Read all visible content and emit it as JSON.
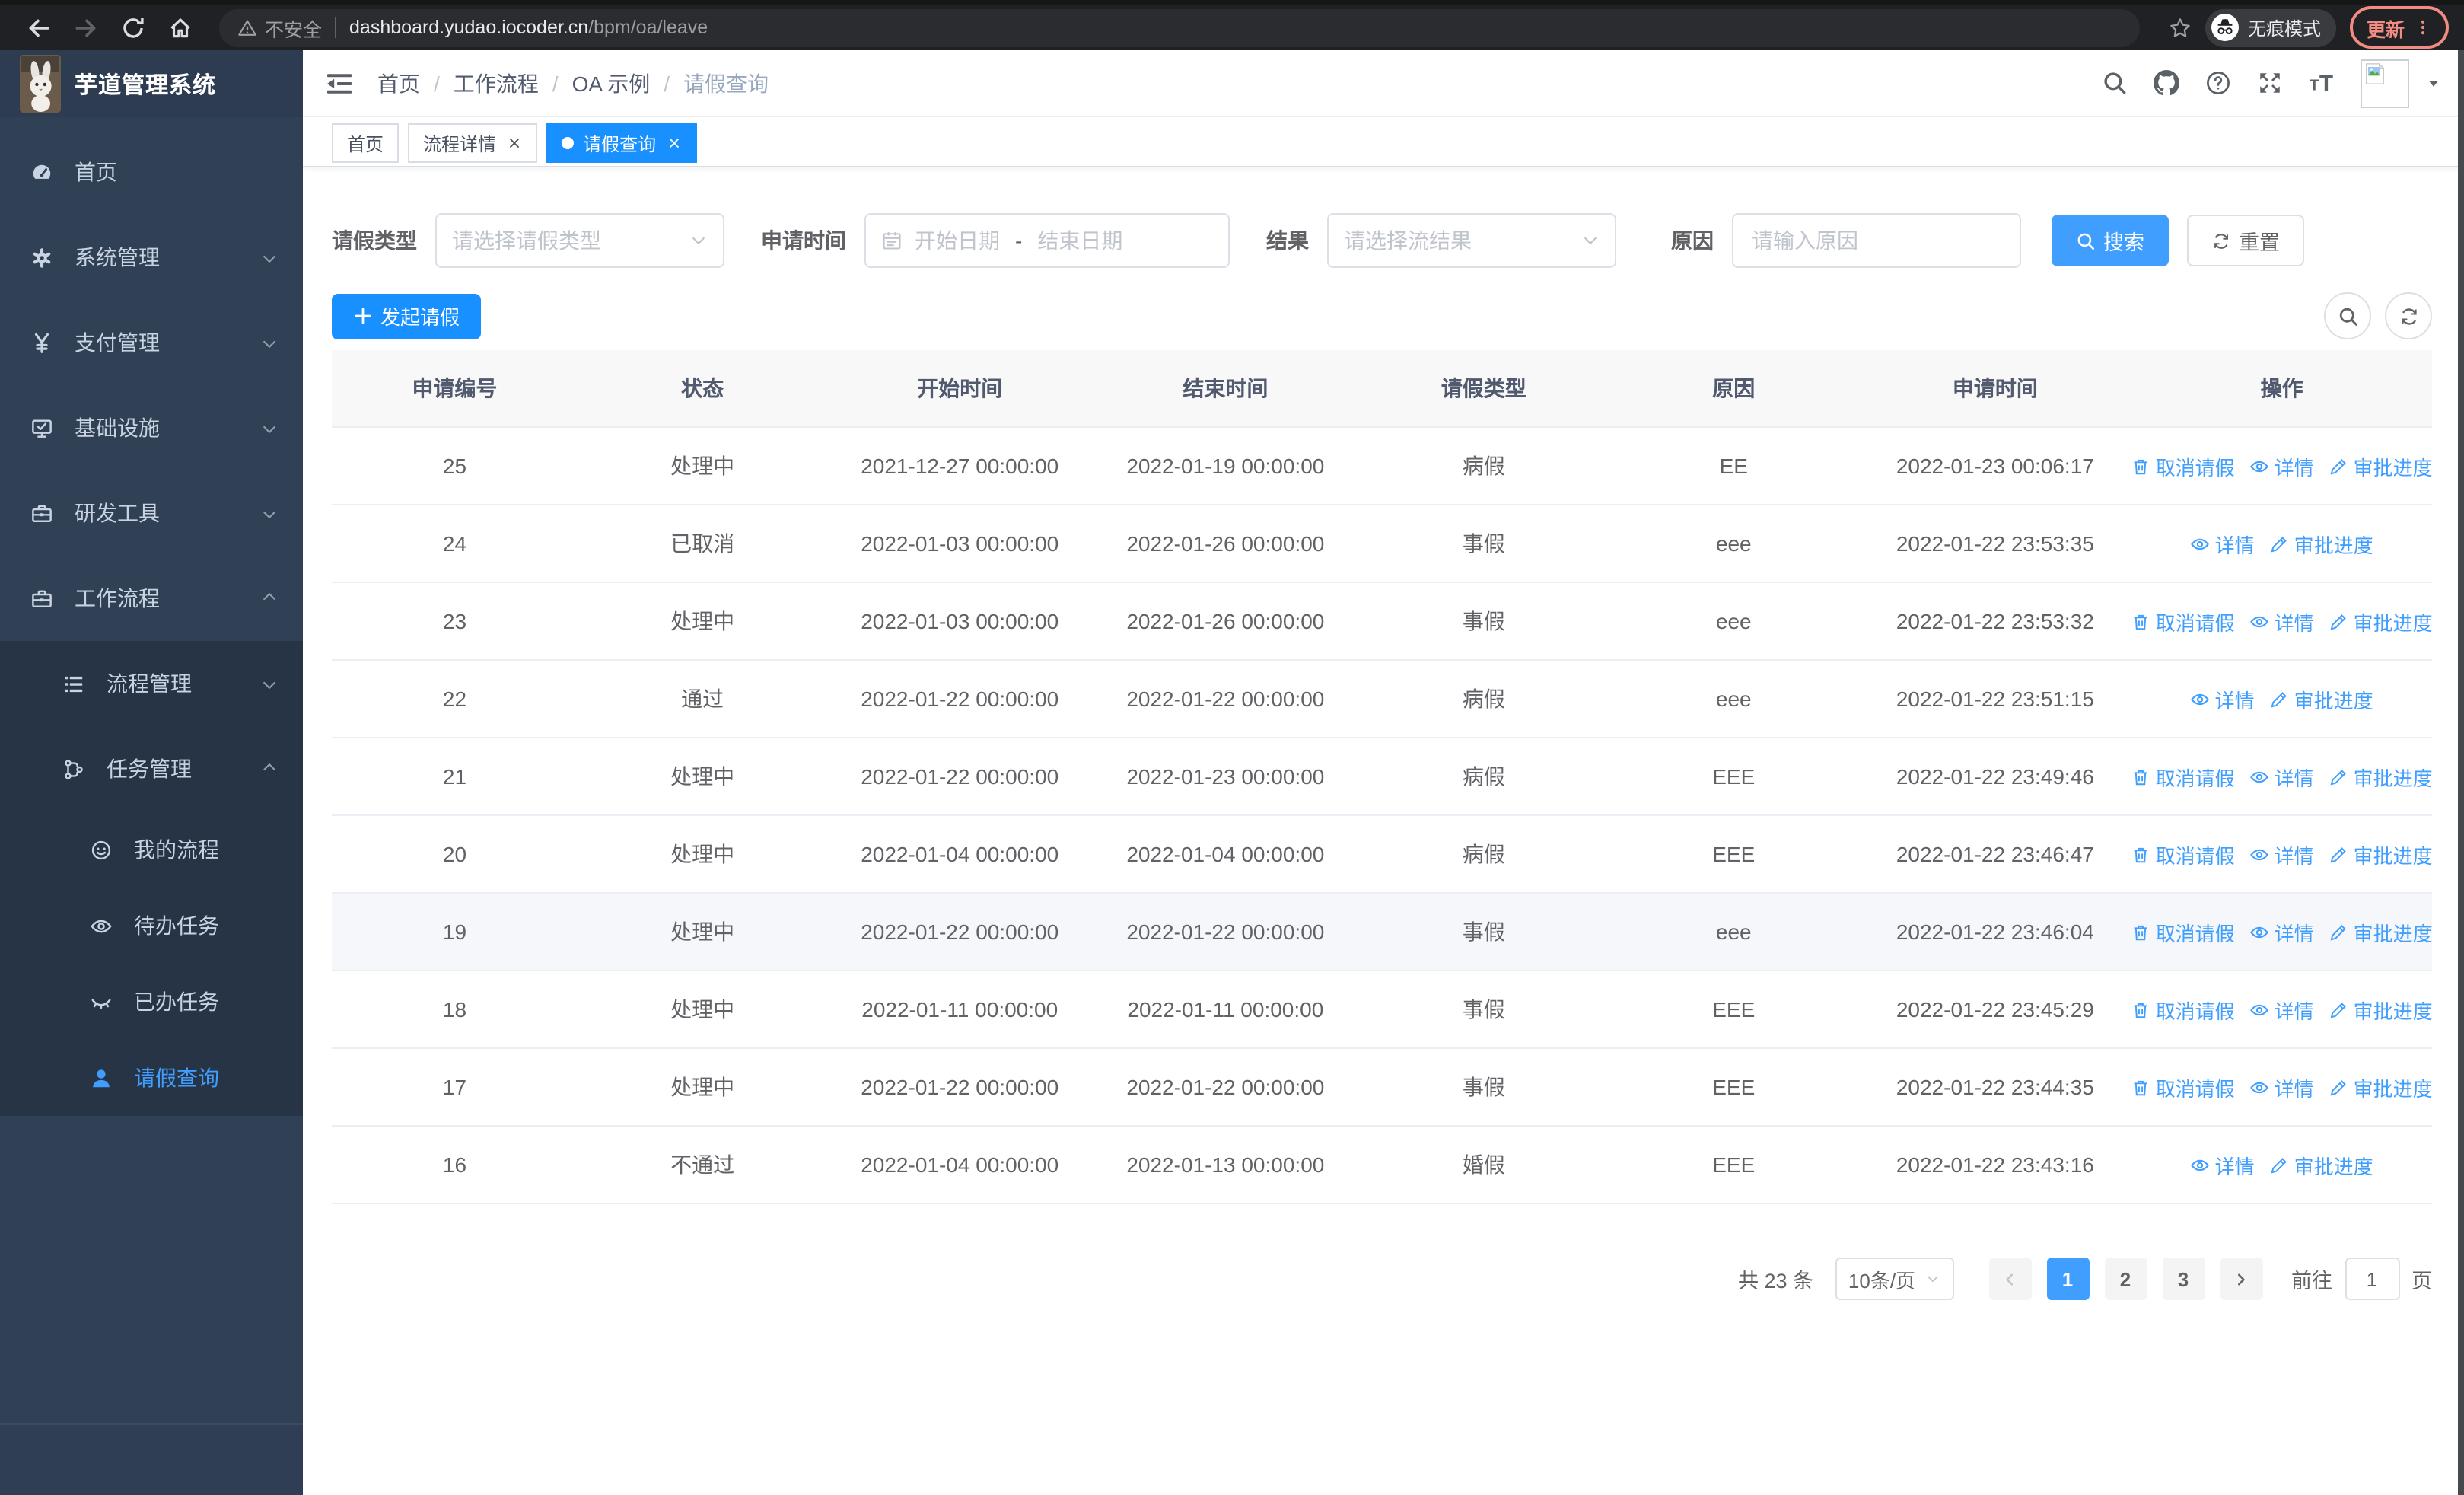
{
  "browser": {
    "security_label": "不安全",
    "url_host": "dashboard.yudao.iocoder.cn",
    "url_path": "/bpm/oa/leave",
    "incognito_label": "无痕模式",
    "update_label": "更新"
  },
  "app": {
    "logo_title": "芋道管理系统",
    "breadcrumb": [
      "首页",
      "工作流程",
      "OA 示例",
      "请假查询"
    ],
    "breadcrumb_separator": "/"
  },
  "tabs": [
    {
      "label": "首页",
      "closable": false,
      "active": false
    },
    {
      "label": "流程详情",
      "closable": true,
      "active": false
    },
    {
      "label": "请假查询",
      "closable": true,
      "active": true
    }
  ],
  "sidebar": {
    "items": [
      {
        "key": "home",
        "label": "首页",
        "icon": "dashboard-icon",
        "level": 1
      },
      {
        "key": "system-mgmt",
        "label": "系统管理",
        "icon": "gear-icon",
        "level": 1,
        "chevron": "down"
      },
      {
        "key": "payment-mgmt",
        "label": "支付管理",
        "icon": "yen-icon",
        "level": 1,
        "chevron": "down"
      },
      {
        "key": "infrastructure",
        "label": "基础设施",
        "icon": "monitor-icon",
        "level": 1,
        "chevron": "down"
      },
      {
        "key": "dev-tools",
        "label": "研发工具",
        "icon": "toolbox-icon",
        "level": 1,
        "chevron": "down"
      },
      {
        "key": "workflow",
        "label": "工作流程",
        "icon": "toolbox-icon",
        "level": 1,
        "chevron": "up"
      },
      {
        "key": "process-mgmt",
        "label": "流程管理",
        "icon": "list-icon",
        "level": 2,
        "chevron": "down"
      },
      {
        "key": "task-mgmt",
        "label": "任务管理",
        "icon": "branch-icon",
        "level": 2,
        "chevron": "up"
      },
      {
        "key": "my-process",
        "label": "我的流程",
        "icon": "face-icon",
        "level": 3
      },
      {
        "key": "todo-tasks",
        "label": "待办任务",
        "icon": "eye-icon",
        "level": 3
      },
      {
        "key": "done-tasks",
        "label": "已办任务",
        "icon": "eye-closed-icon",
        "level": 3
      },
      {
        "key": "leave-query",
        "label": "请假查询",
        "icon": "user-icon",
        "level": 3,
        "active": true
      }
    ]
  },
  "filters": {
    "leave_type": {
      "label": "请假类型",
      "placeholder": "请选择请假类型"
    },
    "apply_time": {
      "label": "申请时间",
      "start_placeholder": "开始日期",
      "separator": "-",
      "end_placeholder": "结束日期"
    },
    "result": {
      "label": "结果",
      "placeholder": "请选择流结果"
    },
    "reason": {
      "label": "原因",
      "placeholder": "请输入原因"
    },
    "search_label": "搜索",
    "reset_label": "重置"
  },
  "toolbar": {
    "create_label": "发起请假"
  },
  "table": {
    "columns": [
      "申请编号",
      "状态",
      "开始时间",
      "结束时间",
      "请假类型",
      "原因",
      "申请时间",
      "操作"
    ],
    "action_labels": {
      "cancel": "取消请假",
      "detail": "详情",
      "progress": "审批进度"
    },
    "rows": [
      {
        "id": "25",
        "status": "处理中",
        "start": "2021-12-27 00:00:00",
        "end": "2022-01-19 00:00:00",
        "type": "病假",
        "reason": "EE",
        "applied": "2022-01-23 00:06:17",
        "actions": [
          "cancel",
          "detail",
          "progress"
        ],
        "highlight": false
      },
      {
        "id": "24",
        "status": "已取消",
        "start": "2022-01-03 00:00:00",
        "end": "2022-01-26 00:00:00",
        "type": "事假",
        "reason": "eee",
        "applied": "2022-01-22 23:53:35",
        "actions": [
          "detail",
          "progress"
        ],
        "highlight": false
      },
      {
        "id": "23",
        "status": "处理中",
        "start": "2022-01-03 00:00:00",
        "end": "2022-01-26 00:00:00",
        "type": "事假",
        "reason": "eee",
        "applied": "2022-01-22 23:53:32",
        "actions": [
          "cancel",
          "detail",
          "progress"
        ],
        "highlight": false
      },
      {
        "id": "22",
        "status": "通过",
        "start": "2022-01-22 00:00:00",
        "end": "2022-01-22 00:00:00",
        "type": "病假",
        "reason": "eee",
        "applied": "2022-01-22 23:51:15",
        "actions": [
          "detail",
          "progress"
        ],
        "highlight": false
      },
      {
        "id": "21",
        "status": "处理中",
        "start": "2022-01-22 00:00:00",
        "end": "2022-01-23 00:00:00",
        "type": "病假",
        "reason": "EEE",
        "applied": "2022-01-22 23:49:46",
        "actions": [
          "cancel",
          "detail",
          "progress"
        ],
        "highlight": false
      },
      {
        "id": "20",
        "status": "处理中",
        "start": "2022-01-04 00:00:00",
        "end": "2022-01-04 00:00:00",
        "type": "病假",
        "reason": "EEE",
        "applied": "2022-01-22 23:46:47",
        "actions": [
          "cancel",
          "detail",
          "progress"
        ],
        "highlight": false
      },
      {
        "id": "19",
        "status": "处理中",
        "start": "2022-01-22 00:00:00",
        "end": "2022-01-22 00:00:00",
        "type": "事假",
        "reason": "eee",
        "applied": "2022-01-22 23:46:04",
        "actions": [
          "cancel",
          "detail",
          "progress"
        ],
        "highlight": true
      },
      {
        "id": "18",
        "status": "处理中",
        "start": "2022-01-11 00:00:00",
        "end": "2022-01-11 00:00:00",
        "type": "事假",
        "reason": "EEE",
        "applied": "2022-01-22 23:45:29",
        "actions": [
          "cancel",
          "detail",
          "progress"
        ],
        "highlight": false
      },
      {
        "id": "17",
        "status": "处理中",
        "start": "2022-01-22 00:00:00",
        "end": "2022-01-22 00:00:00",
        "type": "事假",
        "reason": "EEE",
        "applied": "2022-01-22 23:44:35",
        "actions": [
          "cancel",
          "detail",
          "progress"
        ],
        "highlight": false
      },
      {
        "id": "16",
        "status": "不通过",
        "start": "2022-01-04 00:00:00",
        "end": "2022-01-13 00:00:00",
        "type": "婚假",
        "reason": "EEE",
        "applied": "2022-01-22 23:43:16",
        "actions": [
          "detail",
          "progress"
        ],
        "highlight": false
      }
    ]
  },
  "pagination": {
    "total_label": "共 23 条",
    "page_size": "10条/页",
    "pages": [
      "1",
      "2",
      "3"
    ],
    "active_page": "1",
    "goto_label": "前往",
    "goto_value": "1",
    "goto_suffix": "页"
  },
  "colors": {
    "primary": "#409eff",
    "tab_active": "#1890ff",
    "sidebar_bg": "#304156",
    "sidebar_submenu_bg": "#263445",
    "update_button": "#f28b82"
  }
}
